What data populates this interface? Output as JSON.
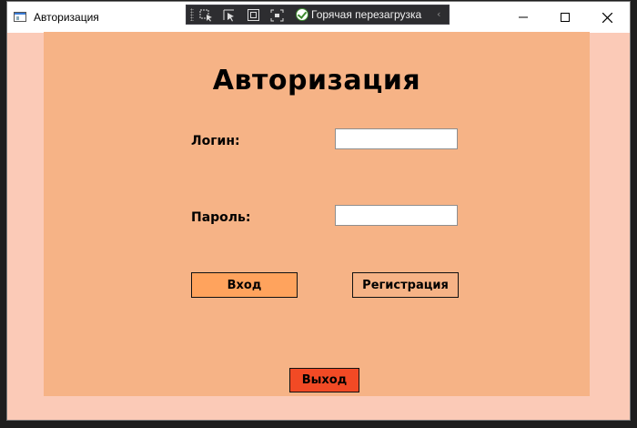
{
  "window": {
    "title": "Авторизация",
    "minimize_icon": "minimize-icon",
    "maximize_icon": "maximize-icon",
    "close_icon": "close-icon"
  },
  "debug_toolbar": {
    "tools": [
      "select-element-icon",
      "pointer-icon",
      "display-layout-icon",
      "track-focus-icon"
    ],
    "hot_reload_label": "Горячая перезагрузка",
    "hot_reload_icon": "checkmark-circle-icon",
    "collapse_glyph": "‹"
  },
  "form": {
    "heading": "Авторизация",
    "login_label": "Логин:",
    "login_value": "",
    "password_label": "Пароль:",
    "password_value": ""
  },
  "buttons": {
    "login": "Вход",
    "register": "Регистрация",
    "exit": "Выход"
  },
  "colors": {
    "window_bg": "#fbcab7",
    "content_bg": "#f6b386",
    "login_button": "#ffa35d",
    "register_button": "#f6b386",
    "exit_button": "#f24a25"
  }
}
